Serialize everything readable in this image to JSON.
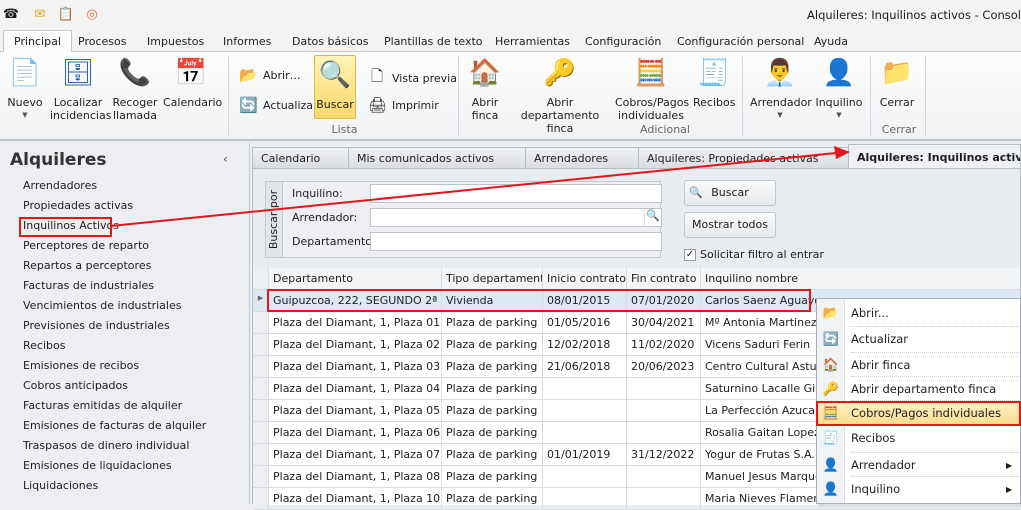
{
  "window": {
    "title": "Alquileres: Inquilinos activos - Consol"
  },
  "quick_access": [
    "phone-icon",
    "mail-icon",
    "clipboard-icon",
    "broadcast-icon"
  ],
  "menu_tabs": [
    "Principal",
    "Procesos",
    "Impuestos",
    "Informes",
    "Datos básicos",
    "Plantillas de texto",
    "Herramientas",
    "Configuración",
    "Configuración personal",
    "Ayuda"
  ],
  "ribbon": {
    "nuevo": "Nuevo",
    "localizar": "Localizar incidencias",
    "recoger": "Recoger llamada",
    "calendario": "Calendario",
    "abrir": "Abrir…",
    "actualizar": "Actualizar",
    "buscar": "Buscar",
    "vista_previa": "Vista previa",
    "imprimir": "Imprimir",
    "group_lista": "Lista",
    "abrir_finca": "Abrir finca",
    "abrir_depto": "Abrir departamento finca",
    "cobros": "Cobros/Pagos individuales",
    "recibos": "Recibos",
    "arrendador": "Arrendador",
    "inquilino": "Inquilino",
    "group_adicional": "Adicional",
    "cerrar": "Cerrar",
    "group_cerrar": "Cerrar"
  },
  "sidebar": {
    "title": "Alquileres",
    "items": [
      "Arrendadores",
      "Propiedades activas",
      "Inquilinos Activos",
      "Perceptores de reparto",
      "Repartos a perceptores",
      "Facturas de industriales",
      "Vencimientos de industriales",
      "Previsiones de industriales",
      "Recibos",
      "Emisiones de recibos",
      "Cobros anticipados",
      "Facturas emitidas de alquiler",
      "Emisiones de facturas de alquiler",
      "Traspasos de dinero individual",
      "Emisiones de liquidaciones",
      "Liquidaciones"
    ],
    "selected": "Inquilinos Activos"
  },
  "doc_tabs": [
    "Calendario",
    "Mis comunicados activos",
    "Arrendadores",
    "Alquileres: Propiedades activas",
    "Alquileres: Inquilinos activos"
  ],
  "search": {
    "group_label": "Buscar por",
    "inquilino_label": "Inquilino:",
    "arrendador_label": "Arrendador:",
    "departamento_label": "Departamento:",
    "inquilino_value": "",
    "arrendador_value": "",
    "departamento_value": "",
    "buscar_button": "Buscar",
    "mostrar_todos_button": "Mostrar todos",
    "solicitar_filtro": "Solicitar filtro al entrar",
    "solicitar_filtro_checked": true
  },
  "grid": {
    "columns": [
      "Departamento",
      "Tipo departamento",
      "Inicio contrato",
      "Fin contrato",
      "Inquilino nombre"
    ],
    "rows": [
      [
        "Guipuzcoa, 222, SEGUNDO 2ª",
        "Vivienda",
        "08/01/2015",
        "07/01/2020",
        "Carlos Saenz Aguayo"
      ],
      [
        "Plaza del Diamant, 1, Plaza 01",
        "Plaza de parking",
        "01/05/2016",
        "30/04/2021",
        "Mº Antonia Martinez Go"
      ],
      [
        "Plaza del Diamant, 1, Plaza 02",
        "Plaza de parking",
        "12/02/2018",
        "11/02/2020",
        "Vicens Saduri Ferin"
      ],
      [
        "Plaza del Diamant, 1, Plaza 03",
        "Plaza de parking",
        "21/06/2018",
        "20/06/2023",
        "Centro Cultural Asturian"
      ],
      [
        "Plaza del Diamant, 1, Plaza 04",
        "Plaza de parking",
        "",
        "",
        "Saturnino Lacalle Gimen"
      ],
      [
        "Plaza del Diamant, 1, Plaza 05",
        "Plaza de parking",
        "",
        "",
        "La Perfección Azucarera"
      ],
      [
        "Plaza del Diamant, 1, Plaza 06",
        "Plaza de parking",
        "",
        "",
        "Rosalia Gaitan Lopez"
      ],
      [
        "Plaza del Diamant, 1, Plaza 07",
        "Plaza de parking",
        "01/01/2019",
        "31/12/2022",
        "Yogur de Frutas S.A."
      ],
      [
        "Plaza del Diamant, 1, Plaza 08",
        "Plaza de parking",
        "",
        "",
        "Manuel Jesus Marques"
      ],
      [
        "Plaza del Diamant, 1, Plaza 10",
        "Plaza de parking",
        "",
        "",
        "Maria Nieves Flamerich"
      ]
    ],
    "selected_row": 0
  },
  "context_menu": {
    "items": [
      {
        "label": "Abrir...",
        "icon": "folder-open-icon",
        "glyph": "📂"
      },
      {
        "label": "Actualizar",
        "icon": "refresh-icon",
        "glyph": "🔄"
      },
      {
        "label": "Abrir finca",
        "icon": "house-icon",
        "glyph": "🏠"
      },
      {
        "label": "Abrir departamento finca",
        "icon": "key-icon",
        "glyph": "🔑"
      },
      {
        "label": "Cobros/Pagos individuales",
        "icon": "calculator-person-icon",
        "glyph": "🧮",
        "highlighted": true
      },
      {
        "label": "Recibos",
        "icon": "receipt-icon",
        "glyph": "🧾"
      },
      {
        "label": "Arrendador",
        "icon": "landlord-icon",
        "glyph": "👤",
        "submenu": true
      },
      {
        "label": "Inquilino",
        "icon": "tenant-icon",
        "glyph": "👤",
        "submenu": true
      }
    ]
  },
  "colors": {
    "annotation": "#e8141a",
    "highlight": "#fbdc8a",
    "selection": "#dde8f5"
  }
}
